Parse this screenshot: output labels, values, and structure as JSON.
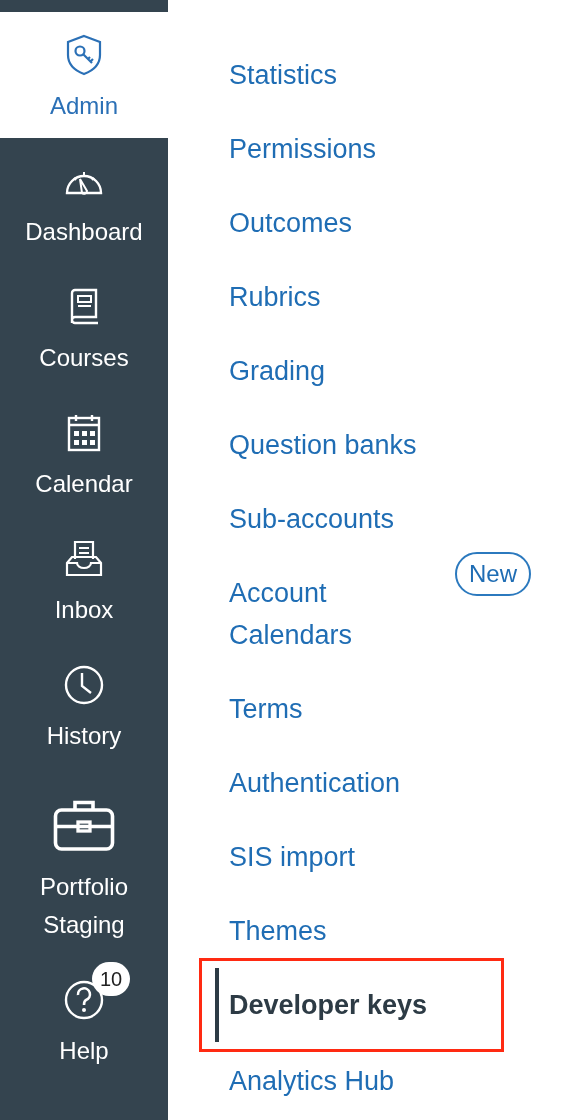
{
  "global_nav": [
    {
      "label": "Admin",
      "selected": true
    },
    {
      "label": "Dashboard",
      "selected": false
    },
    {
      "label": "Courses",
      "selected": false
    },
    {
      "label": "Calendar",
      "selected": false
    },
    {
      "label": "Inbox",
      "selected": false
    },
    {
      "label": "History",
      "selected": false
    },
    {
      "label": "Portfolio Staging",
      "selected": false
    },
    {
      "label": "Help",
      "selected": false,
      "badge": "10"
    }
  ],
  "account_nav": [
    {
      "label": "Statistics",
      "selected": false
    },
    {
      "label": "Permissions",
      "selected": false
    },
    {
      "label": "Outcomes",
      "selected": false
    },
    {
      "label": "Rubrics",
      "selected": false
    },
    {
      "label": "Grading",
      "selected": false
    },
    {
      "label": "Question banks",
      "selected": false
    },
    {
      "label": "Sub-accounts",
      "selected": false
    },
    {
      "label": "Account Calendars",
      "selected": false,
      "badge": "New"
    },
    {
      "label": "Terms",
      "selected": false
    },
    {
      "label": "Authentication",
      "selected": false
    },
    {
      "label": "SIS import",
      "selected": false
    },
    {
      "label": "Themes",
      "selected": false
    },
    {
      "label": "Developer keys",
      "selected": true,
      "highlighted": true
    },
    {
      "label": "Analytics Hub",
      "selected": false
    }
  ]
}
